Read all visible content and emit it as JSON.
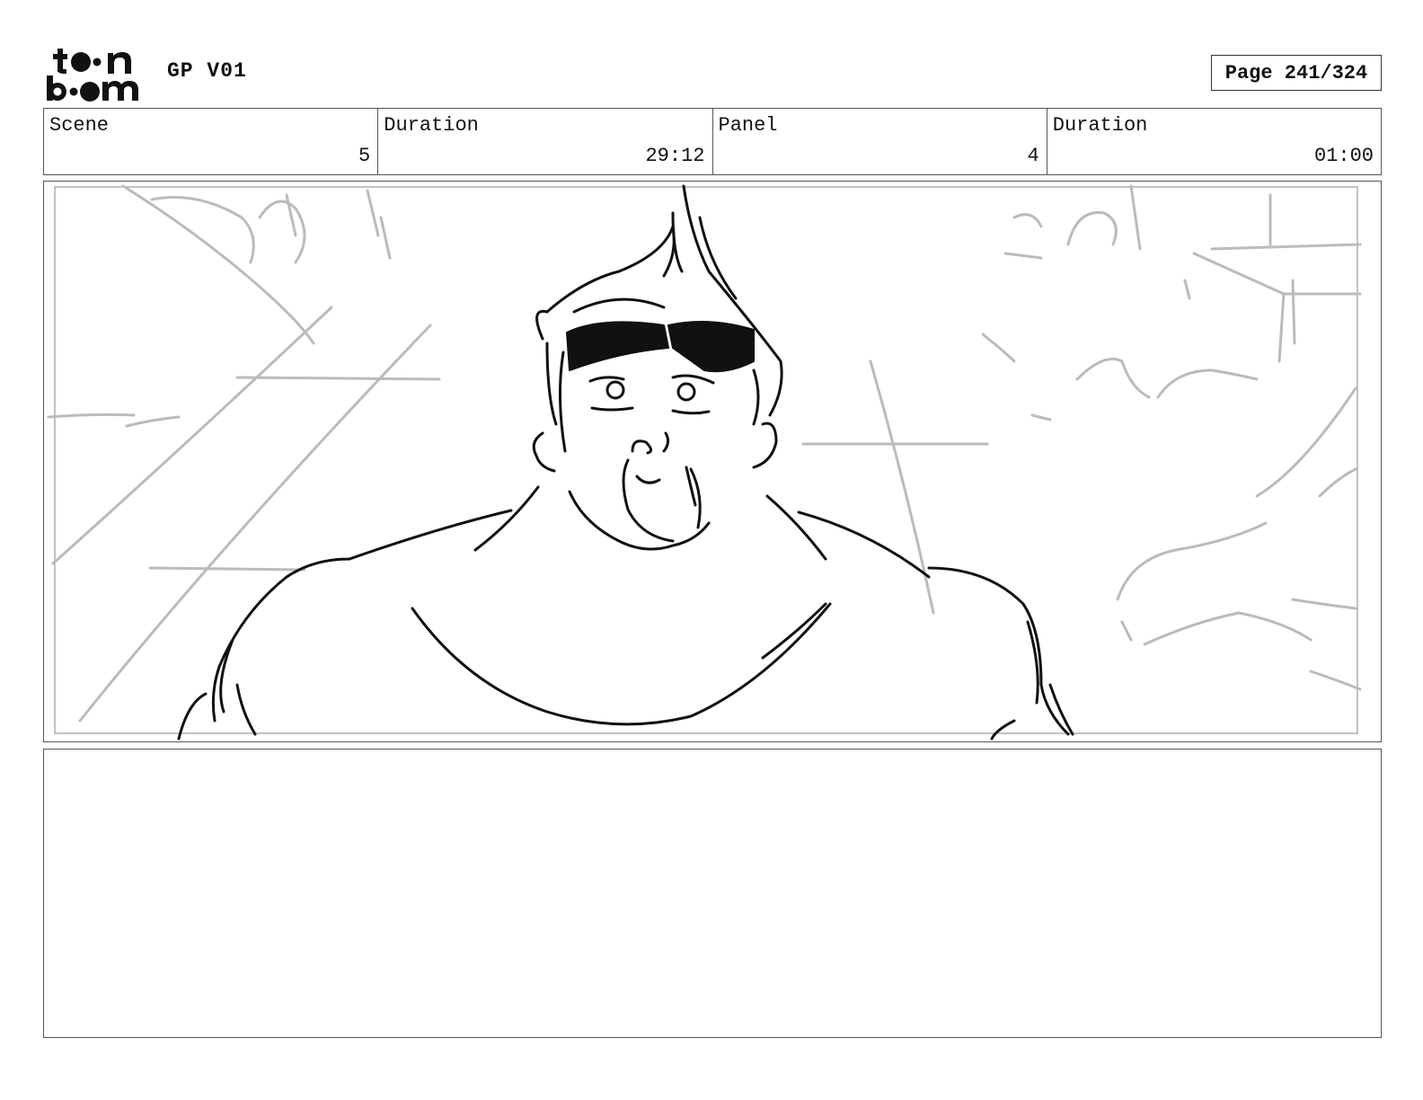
{
  "header": {
    "brand_icon": "toonboom-logo",
    "project_title": "GP V01",
    "page_label": "Page 241/324"
  },
  "info": {
    "scene_label": "Scene",
    "scene_value": "5",
    "scene_duration_label": "Duration",
    "scene_duration_value": "29:12",
    "panel_label": "Panel",
    "panel_value": "4",
    "panel_duration_label": "Duration",
    "panel_duration_value": "01:00"
  },
  "panel": {
    "drawing": "character-sketch-image"
  },
  "notes": {
    "text": ""
  }
}
